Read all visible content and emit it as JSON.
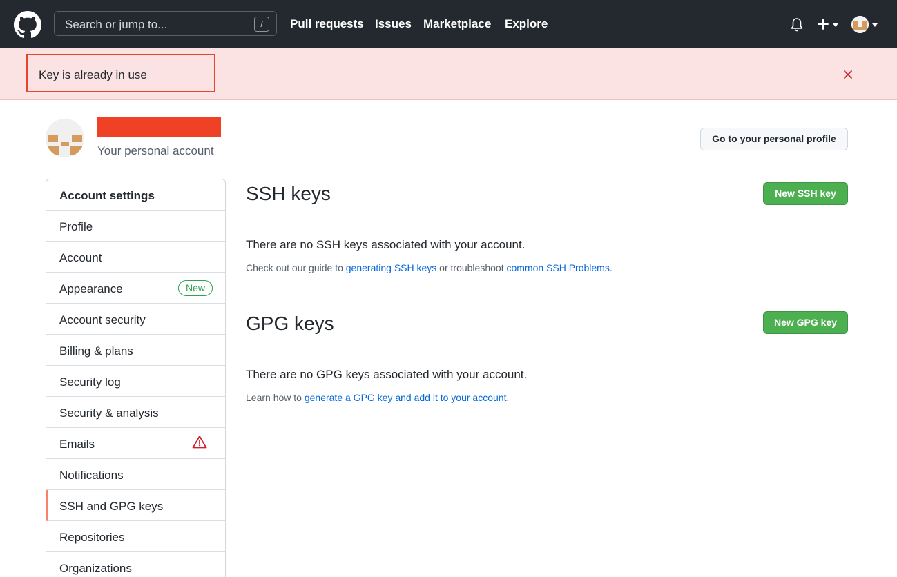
{
  "header": {
    "search_placeholder": "Search or jump to...",
    "search_shortcut": "/",
    "nav": [
      "Pull requests",
      "Issues",
      "Marketplace",
      "Explore"
    ]
  },
  "flash": {
    "message": "Key is already in use",
    "close_icon": "x-icon"
  },
  "account": {
    "subtitle": "Your personal account",
    "profile_button": "Go to your personal profile"
  },
  "sidebar": {
    "heading": "Account settings",
    "items": [
      {
        "label": "Profile"
      },
      {
        "label": "Account"
      },
      {
        "label": "Appearance",
        "badge": "New"
      },
      {
        "label": "Account security"
      },
      {
        "label": "Billing & plans"
      },
      {
        "label": "Security log"
      },
      {
        "label": "Security & analysis"
      },
      {
        "label": "Emails",
        "icon": "alert-icon"
      },
      {
        "label": "Notifications"
      },
      {
        "label": "SSH and GPG keys",
        "selected": true
      },
      {
        "label": "Repositories"
      },
      {
        "label": "Organizations"
      }
    ]
  },
  "ssh": {
    "title": "SSH keys",
    "button": "New SSH key",
    "empty": "There are no SSH keys associated with your account.",
    "help_prefix": "Check out our guide to ",
    "help_link1": "generating SSH keys",
    "help_mid": " or troubleshoot ",
    "help_link2": "common SSH Problems",
    "help_suffix": "."
  },
  "gpg": {
    "title": "GPG keys",
    "button": "New GPG key",
    "empty": "There are no GPG keys associated with your account.",
    "help_prefix": "Learn how to ",
    "help_link": "generate a GPG key and add it to your account",
    "help_suffix": "."
  },
  "colors": {
    "header_bg": "#24292f",
    "flash_bg": "#fbe3e3",
    "flash_highlight": "#e8452f",
    "redaction": "#ee4126",
    "primary_button": "#4caf50",
    "link": "#0969da",
    "selected_accent": "#f9826c"
  }
}
